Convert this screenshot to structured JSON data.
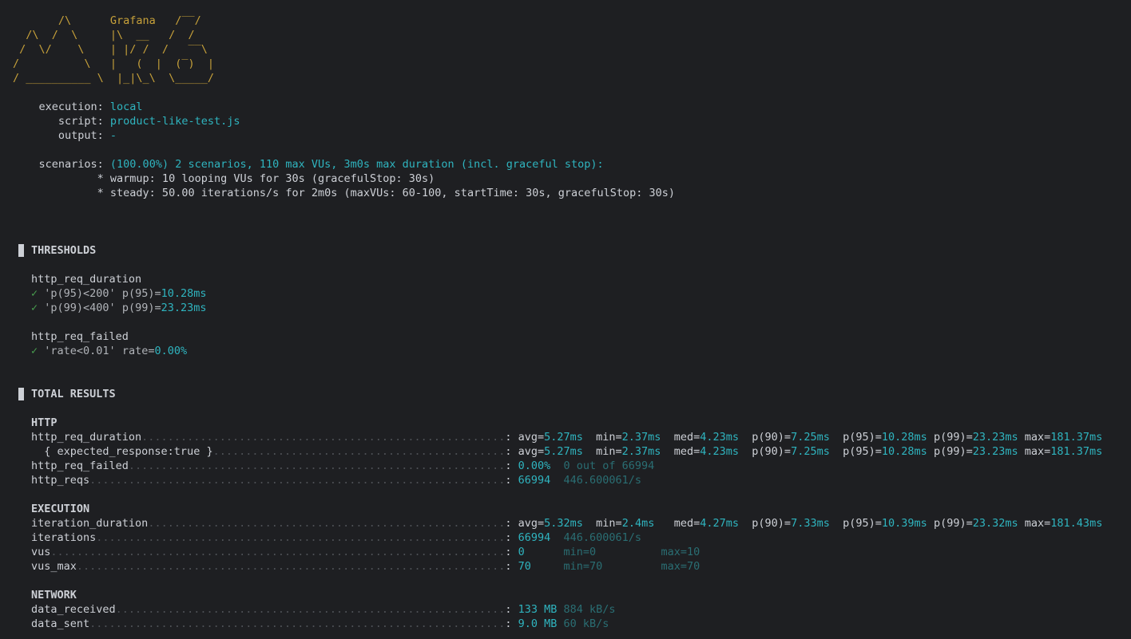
{
  "logo": {
    "lines": [
      "       /\\      Grafana   /‾‾/  ",
      "  /\\  /  \\     |\\  __   /  /   ",
      " /  \\/    \\    | |/ /  /   ‾‾\\ ",
      "/          \\   |   (  |  (‾)  |",
      "/ __________ \\  |_|\\_\\  \\_____/ "
    ]
  },
  "header": {
    "execution_label": "    execution: ",
    "execution_value": "local",
    "script_label": "       script: ",
    "script_value": "product-like-test.js",
    "output_label": "       output: ",
    "output_value": "-",
    "scenarios_label": "    scenarios: ",
    "scenarios_value": "(100.00%) 2 scenarios, 110 max VUs, 3m0s max duration (incl. graceful stop):",
    "warmup": "             * warmup: 10 looping VUs for 30s (gracefulStop: 30s)",
    "steady": "             * steady: 50.00 iterations/s for 2m0s (maxVUs: 60-100, startTime: 30s, gracefulStop: 30s)"
  },
  "thresholds": {
    "title": "THRESHOLDS",
    "groups": [
      {
        "metric": "http_req_duration",
        "checks": [
          {
            "expr": "'p(95)<200' p(95)=",
            "value": "10.28ms"
          },
          {
            "expr": "'p(99)<400' p(99)=",
            "value": "23.23ms"
          }
        ]
      },
      {
        "metric": "http_req_failed",
        "checks": [
          {
            "expr": "'rate<0.01' rate=",
            "value": "0.00%"
          }
        ]
      }
    ],
    "check_mark": "✓"
  },
  "results": {
    "title": "TOTAL RESULTS",
    "http_title": "HTTP",
    "execution_title": "EXECUTION",
    "network_title": "NETWORK",
    "rows": {
      "http_req_duration": {
        "name": "http_req_duration",
        "stats": [
          [
            "avg=",
            "5.27ms"
          ],
          [
            "min=",
            "2.37ms"
          ],
          [
            "med=",
            "4.23ms"
          ],
          [
            "p(90)=",
            "7.25ms"
          ],
          [
            "p(95)=",
            "10.28ms"
          ],
          [
            "p(99)=",
            "23.23ms"
          ],
          [
            "max=",
            "181.37ms"
          ]
        ]
      },
      "expected_response": {
        "name": "  { expected_response:true }",
        "stats": [
          [
            "avg=",
            "5.27ms"
          ],
          [
            "min=",
            "2.37ms"
          ],
          [
            "med=",
            "4.23ms"
          ],
          [
            "p(90)=",
            "7.25ms"
          ],
          [
            "p(95)=",
            "10.28ms"
          ],
          [
            "p(99)=",
            "23.23ms"
          ],
          [
            "max=",
            "181.37ms"
          ]
        ]
      },
      "http_req_failed": {
        "name": "http_req_failed",
        "value": "0.00%",
        "extra": "0 out of 66994"
      },
      "http_reqs": {
        "name": "http_reqs",
        "value": "66994",
        "extra": "446.600061/s"
      },
      "iteration_duration": {
        "name": "iteration_duration",
        "stats": [
          [
            "avg=",
            "5.32ms"
          ],
          [
            "min=",
            "2.4ms"
          ],
          [
            "med=",
            "4.27ms"
          ],
          [
            "p(90)=",
            "7.33ms"
          ],
          [
            "p(95)=",
            "10.39ms"
          ],
          [
            "p(99)=",
            "23.32ms"
          ],
          [
            "max=",
            "181.43ms"
          ]
        ]
      },
      "iterations": {
        "name": "iterations",
        "value": "66994",
        "extra": "446.600061/s"
      },
      "vus": {
        "name": "vus",
        "value": "0",
        "min": "min=0",
        "max": "max=10"
      },
      "vus_max": {
        "name": "vus_max",
        "value": "70",
        "min": "min=70",
        "max": "max=70"
      },
      "data_received": {
        "name": "data_received",
        "value": "133 MB",
        "extra": "884 kB/s"
      },
      "data_sent": {
        "name": "data_sent",
        "value": "9.0 MB",
        "extra": "60 kB/s"
      }
    }
  }
}
